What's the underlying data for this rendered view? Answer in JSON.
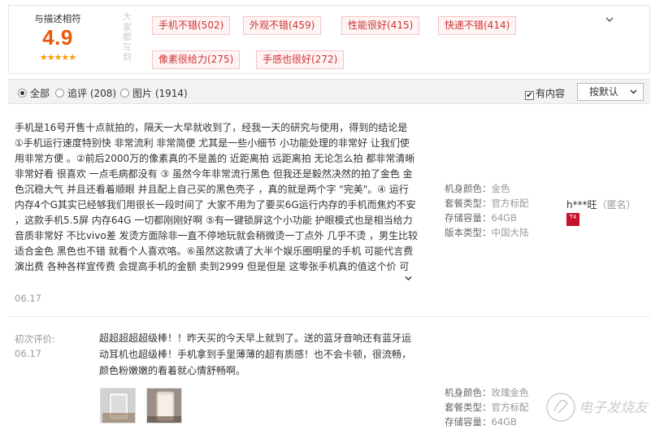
{
  "summary": {
    "score_caption": "与描述相符",
    "score": "4.9",
    "stars": "★★★★★",
    "tag_title": "大家都写到",
    "toggle_icon": "chevron-down",
    "tags": [
      "手机不错(502)",
      "外观不错(459)",
      "性能很好(415)",
      "快递不错(414)",
      "像素很给力(275)",
      "手感也很好(272)"
    ]
  },
  "filter": {
    "all": "全部",
    "append": "追评 (208)",
    "images": "图片 (1914)",
    "has_content": "有内容",
    "has_content_checked": true,
    "sort_label": "按默认"
  },
  "review1": {
    "lines": [
      "手机是16号开售十点就拍的，隔天一大早就收到了，经我一天的研究与使用，得到的结论是",
      "①手机运行速度特别快 非常流利 非常简便 尤其是一些小细节 小功能处理的非常好 让我们使",
      "用非常方便 。②前后2000万的像素真的不是盖的 近距离拍 远距离拍 无论怎么拍 都非常清晰",
      "非常好看 很喜欢 一点毛病都没有 ③ 虽然今年非常流行黑色 但我还是毅然决然的拍了金色 金",
      "色沉稳大气 并且还看着顺眼 并且配上自己买的黑色壳子 ，真的就是两个字 \"完美\"。④ 运行",
      "内存4个G其实已经够我们用很长一段时间了 大家不用为了要买6G运行内存的手机而焦灼不安",
      "，这款手机5.5屏 内存64G 一切都刚刚好啊 ⑤有一键锁屏这个小功能 护眼模式也是相当给力",
      "音质非常好 不比vivo差 发烫方面除非一直不停地玩就会稍微烫一丁点外 几乎不烫 ，男生比较",
      "适合金色 黑色也不错 就看个人喜欢咯。⑥虽然这款请了大半个娱乐圈明星的手机 可能代言费",
      "演出费 各种各样宣传费 会提高手机的金额 卖到2999 但是但是 这零张手机真的值这个价 可"
    ],
    "date": "06.17",
    "props": [
      {
        "k": "机身颜色：",
        "v": "金色"
      },
      {
        "k": "套餐类型：",
        "v": "官方标配"
      },
      {
        "k": "存储容量：",
        "v": "64GB"
      },
      {
        "k": "版本类型：",
        "v": "中国大陆"
      }
    ],
    "user": "h***旺",
    "user_anon": "（匿名）",
    "badge": "T4"
  },
  "review2": {
    "first_label": "初次评价:",
    "date": "06.17",
    "lines": [
      "超超超超超级棒！！昨天买的今天早上就到了。送的蓝牙音响还有蓝牙运",
      "动耳机也超级棒！手机拿到手里薄薄的超有质感！也不会卡顿，很流畅，",
      "颜色粉嫩嫩的看着就心情舒畅啊。"
    ],
    "props": [
      {
        "k": "机身颜色：",
        "v": "玫瑰金色"
      },
      {
        "k": "套餐类型：",
        "v": "官方标配"
      },
      {
        "k": "存储容量：",
        "v": "64GB"
      }
    ]
  },
  "watermark": "电子发烧友",
  "colors": {
    "accent": "#e9580c",
    "tag_text": "#cc3333",
    "tag_border": "#f4c4c4",
    "star": "#ff9900"
  }
}
